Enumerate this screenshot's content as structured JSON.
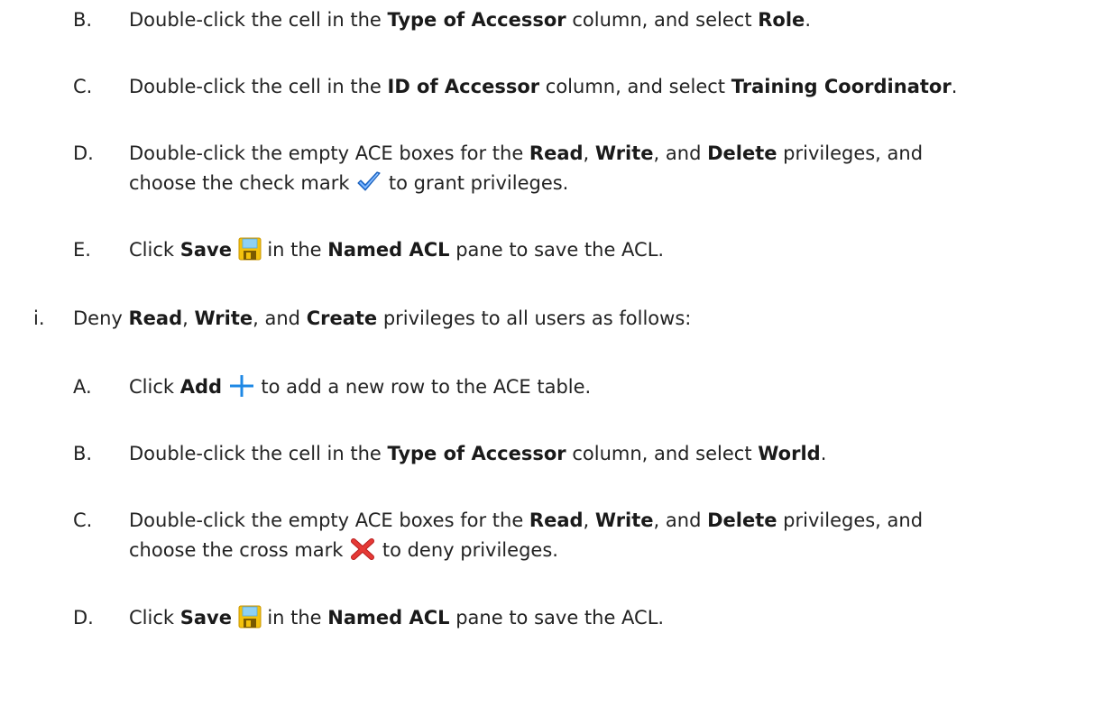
{
  "steps": [
    {
      "marker": "B.",
      "parts": [
        "Double-click the cell in the ",
        "Type of Accessor",
        " column, and select ",
        "Role",
        "."
      ]
    },
    {
      "marker": "C.",
      "parts": [
        "Double-click the cell in the ",
        "ID of Accessor",
        " column, and select ",
        "Training Coordinator",
        "."
      ]
    },
    {
      "marker": "D.",
      "line1": [
        "Double-click the empty ACE boxes for the ",
        "Read",
        ", ",
        "Write",
        ", and ",
        "Delete",
        " privileges, and"
      ],
      "line2": [
        "choose the check mark ",
        " to grant privileges."
      ],
      "icon": "checkmark-icon"
    },
    {
      "marker": "E.",
      "parts": [
        "Click ",
        "Save",
        " in the ",
        "Named ACL",
        " pane to save the ACL."
      ],
      "icon": "save-icon"
    },
    {
      "marker": "i.",
      "parts": [
        "Deny ",
        "Read",
        ", ",
        "Write",
        ", and ",
        "Create",
        " privileges to all users as follows:"
      ]
    },
    {
      "marker": "A.",
      "parts": [
        "Click ",
        "Add",
        " to add a new row to the ACE table."
      ],
      "icon": "add-icon"
    },
    {
      "marker": "B.",
      "parts": [
        "Double-click the cell in the ",
        "Type of Accessor",
        " column, and select ",
        "World",
        "."
      ]
    },
    {
      "marker": "C.",
      "line1": [
        "Double-click the empty ACE boxes for the ",
        "Read",
        ", ",
        "Write",
        ", and ",
        "Delete",
        " privileges, and"
      ],
      "line2": [
        "choose the cross mark ",
        " to deny privileges."
      ],
      "icon": "cross-icon"
    },
    {
      "marker": "D.",
      "parts": [
        "Click ",
        "Save",
        " in the ",
        "Named ACL",
        " pane to save the ACL."
      ],
      "icon": "save-icon"
    }
  ],
  "colors": {
    "text": "#222222",
    "add_icon": "#1e88e5",
    "cross_icon": "#e53935",
    "check_icon": "#2f80ed",
    "save_icon": "#f4c20d"
  }
}
